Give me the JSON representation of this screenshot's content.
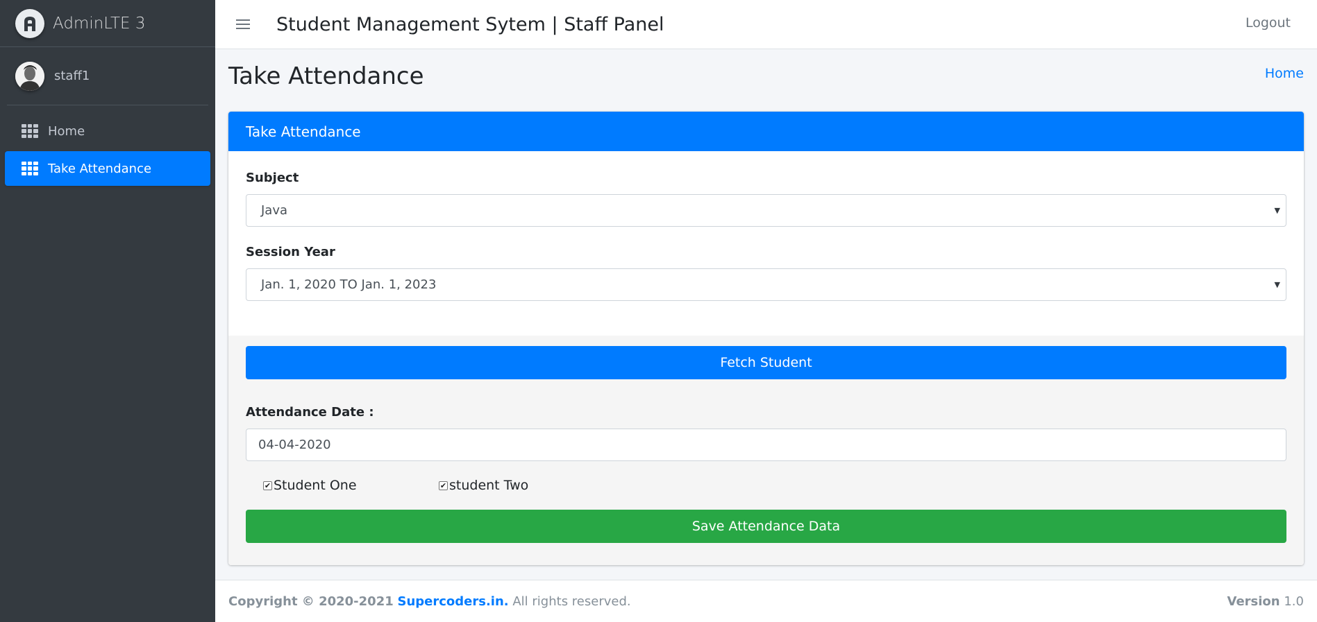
{
  "brand": {
    "name": "AdminLTE 3",
    "logo_icon": "adminlte-logo-icon"
  },
  "user": {
    "name": "staff1"
  },
  "sidebar": {
    "items": [
      {
        "label": "Home",
        "icon": "grid-icon",
        "active": false
      },
      {
        "label": "Take Attendance",
        "icon": "grid-icon",
        "active": true
      }
    ]
  },
  "header": {
    "title": "Student Management Sytem | Staff Panel",
    "logout_label": "Logout"
  },
  "page": {
    "title": "Take Attendance",
    "breadcrumb": "Home"
  },
  "card": {
    "title": "Take Attendance",
    "subject_label": "Subject",
    "subject_value": "Java",
    "session_label": "Session Year",
    "session_value": "Jan. 1, 2020 TO Jan. 1, 2023",
    "fetch_label": "Fetch Student",
    "date_label": "Attendance Date :",
    "date_value": "04-04-2020",
    "students": [
      {
        "name": "Student One",
        "checked": true
      },
      {
        "name": "student Two",
        "checked": true
      }
    ],
    "save_label": "Save Attendance Data"
  },
  "footer": {
    "copyright_prefix": "Copyright © 2020-2021",
    "brand_link": "Supercoders.in.",
    "rights": "All rights reserved.",
    "version_label": "Version",
    "version_value": "1.0"
  },
  "colors": {
    "primary": "#007bff",
    "success": "#28a745",
    "sidebar": "#343a40"
  }
}
